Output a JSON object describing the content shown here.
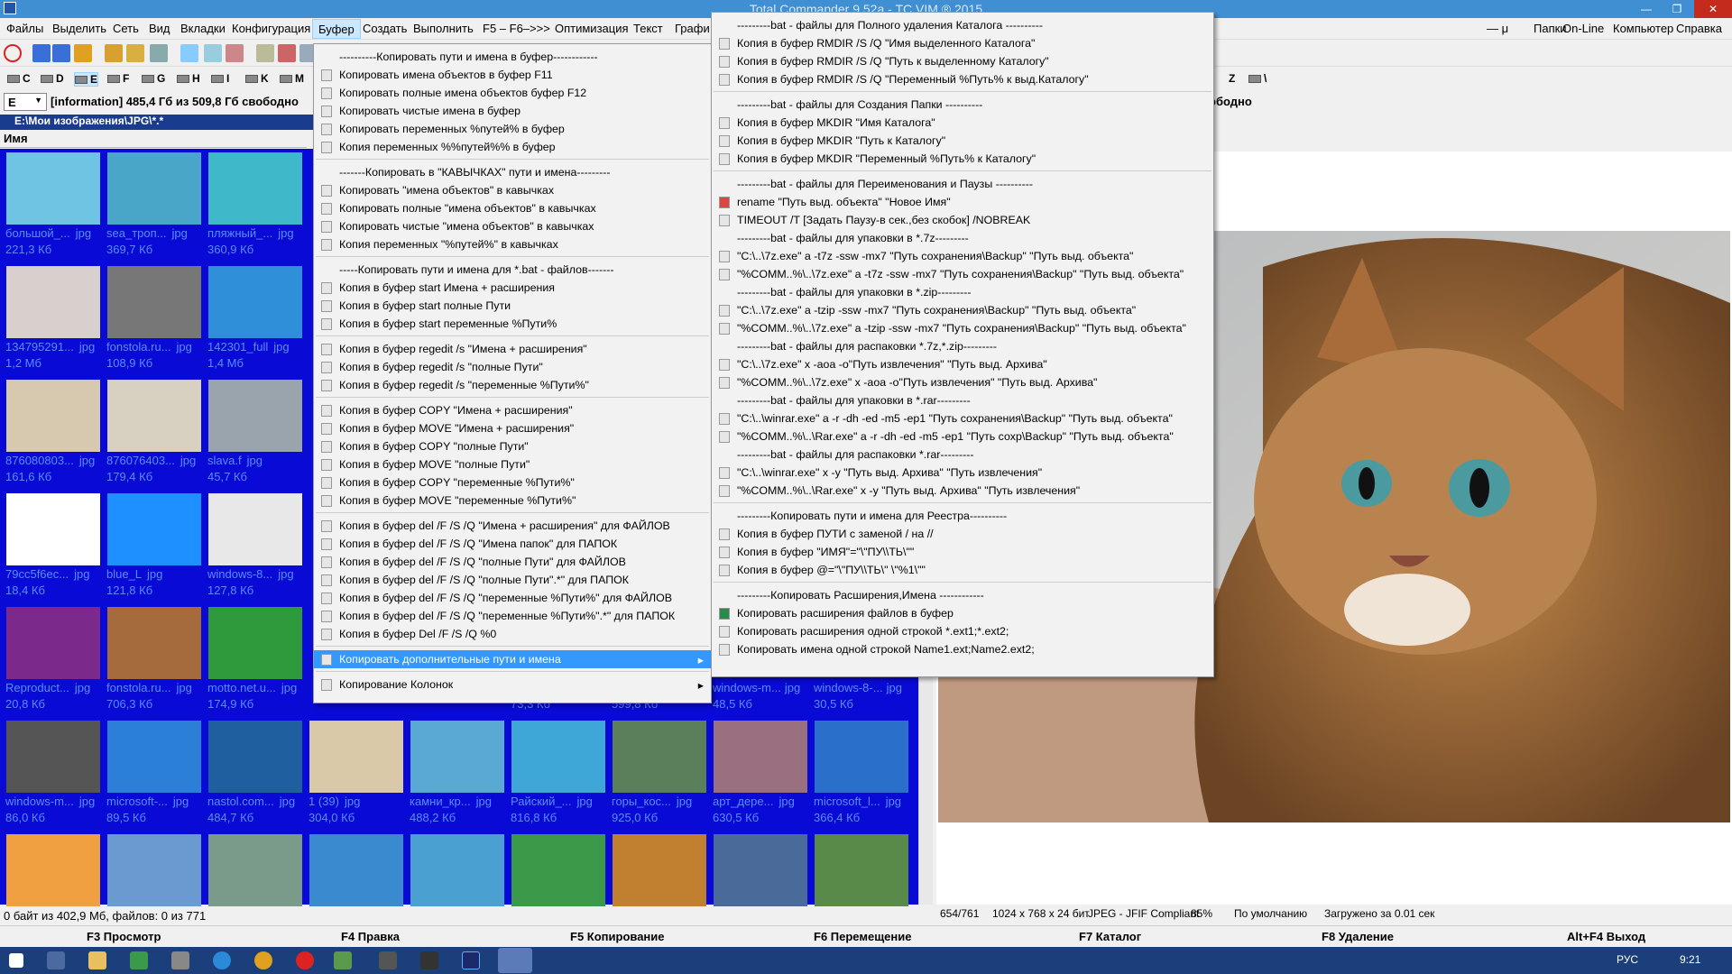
{
  "window": {
    "title": "Total Commander 9.52a - TC VIM ® 2015",
    "minimize": "—",
    "maximize": "❐",
    "close": "✕"
  },
  "menubar": {
    "items": [
      "Файлы",
      "Выделить",
      "Сеть",
      "Вид",
      "Вкладки",
      "Конфигурация",
      "Буфер",
      "Создать",
      "Выполнить",
      "F5 – F6–>>>",
      "Оптимизация",
      "Текст",
      "Графи"
    ],
    "right": [
      "— μ",
      "Папки",
      "On-Line",
      "Компьютер",
      "Справка"
    ]
  },
  "drives": {
    "left": [
      "C",
      "D",
      "E",
      "F",
      "G",
      "H",
      "I",
      "K",
      "M"
    ],
    "right": [
      "Z",
      "\\"
    ]
  },
  "left_panel": {
    "drive": "E",
    "info": "[information]  485,4 Гб из 509,8 Гб свободно",
    "path": "E:\\Мои изображения\\JPG\\*.*",
    "column": "Имя",
    "status": "0 байт из 402,9 Мб, файлов: 0 из 771"
  },
  "right_panel": {
    "free": "ободно"
  },
  "thumbnails": [
    {
      "name": "большой_...",
      "ext": "jpg",
      "size": "221,3 Кб",
      "color": "#6fc3e3"
    },
    {
      "name": "sea_троп...",
      "ext": "jpg",
      "size": "369,7 Кб",
      "color": "#4aa6c8"
    },
    {
      "name": "пляжный_...",
      "ext": "jpg",
      "size": "360,9 Кб",
      "color": "#3fb9c9"
    },
    {
      "name": "134795291...",
      "ext": "jpg",
      "size": "1,2 Мб",
      "color": "#d8d0cc"
    },
    {
      "name": "fonstola.ru...",
      "ext": "jpg",
      "size": "108,9 Кб",
      "color": "#777"
    },
    {
      "name": "142301_full",
      "ext": "jpg",
      "size": "1,4 Мб",
      "color": "#2f8fd8"
    },
    {
      "name": "876080803...",
      "ext": "jpg",
      "size": "161,6 Кб",
      "color": "#d6c9b0"
    },
    {
      "name": "876076403...",
      "ext": "jpg",
      "size": "179,4 Кб",
      "color": "#d8d0c0"
    },
    {
      "name": "slava.f",
      "ext": "jpg",
      "size": "45,7 Кб",
      "color": "#9aa4ac"
    },
    {
      "name": "79cc5f6ec...",
      "ext": "jpg",
      "size": "18,4 Кб",
      "color": "#ffffff"
    },
    {
      "name": "blue_L",
      "ext": "jpg",
      "size": "121,8 Кб",
      "color": "#1e90ff"
    },
    {
      "name": "windows-8...",
      "ext": "jpg",
      "size": "127,8 Кб",
      "color": "#e8e8e8"
    },
    {
      "name": "Reproduct...",
      "ext": "jpg",
      "size": "20,8 Кб",
      "color": "#7b2a8c"
    },
    {
      "name": "fonstola.ru...",
      "ext": "jpg",
      "size": "706,3 Кб",
      "color": "#a56b3c"
    },
    {
      "name": "motto.net.u...",
      "ext": "jpg",
      "size": "174,9 Кб",
      "color": "#2e9a3c"
    },
    {
      "name": "windows-m...",
      "ext": "jpg",
      "size": "86,0 Кб",
      "color": "#555"
    },
    {
      "name": "microsoft-...",
      "ext": "jpg",
      "size": "89,5 Кб",
      "color": "#2b7fd6"
    },
    {
      "name": "nastol.com...",
      "ext": "jpg",
      "size": "484,7 Кб",
      "color": "#1f5f9f"
    },
    {
      "name": "1 (39)",
      "ext": "jpg",
      "size": "304,0 Кб",
      "color": "#d9c9a9"
    },
    {
      "name": "камни_кр...",
      "ext": "jpg",
      "size": "488,2 Кб",
      "color": "#5aa9d4"
    },
    {
      "name": "Райский_...",
      "ext": "jpg",
      "size": "816,8 Кб",
      "color": "#3fa6d8"
    },
    {
      "name": "горы_кос...",
      "ext": "jpg",
      "size": "925,0 Кб",
      "color": "#5a7f5a"
    },
    {
      "name": "арт_дере...",
      "ext": "jpg",
      "size": "630,5 Кб",
      "color": "#9a6f7f"
    },
    {
      "name": "microsoft_l...",
      "ext": "jpg",
      "size": "366,4 Кб",
      "color": "#2a6fc9"
    }
  ],
  "row7_sizes": [
    "73,3 Кб",
    "599,8 Кб"
  ],
  "row7_right": [
    {
      "name": "windows-m...",
      "ext": "jpg",
      "size": "48,5 Кб"
    },
    {
      "name": "windows-8-...",
      "ext": "jpg",
      "size": "30,5 Кб"
    }
  ],
  "viewer_status": [
    "654/761",
    "1024 x 768 x 24 бит",
    "JPEG - JFIF Compliant",
    "85%",
    "По умолчанию",
    "Загружено за 0.01 сек"
  ],
  "fkeys": [
    "F3 Просмотр",
    "F4 Правка",
    "F5 Копирование",
    "F6 Перемещение",
    "F7 Каталог",
    "F8 Удаление",
    "Alt+F4 Выход"
  ],
  "taskbar": {
    "lang": "РУС",
    "time": "9:21"
  },
  "menu1": [
    {
      "t": "----------Копировать пути и имена в буфер------------",
      "h": true
    },
    {
      "t": "Копировать имена объектов в буфер    F11"
    },
    {
      "t": "Копировать полные имена объектов буфер    F12"
    },
    {
      "t": "Копировать чистые имена в буфер"
    },
    {
      "t": "Копировать переменных %путей% в буфер"
    },
    {
      "t": "Копия переменных %%путей%% в буфер"
    },
    {
      "sep": true
    },
    {
      "t": "-------Копировать в \"КАВЫЧКАХ\" пути и имена---------",
      "h": true
    },
    {
      "t": "Копировать \"имена объектов\" в кавычках"
    },
    {
      "t": "Копировать полные \"имена объектов\" в кавычках"
    },
    {
      "t": "Копировать чистые \"имена объектов\" в кавычках"
    },
    {
      "t": "Копия переменных \"%путей%\" в кавычках"
    },
    {
      "sep": true
    },
    {
      "t": "-----Копировать пути и имена для *.bat - файлов-------",
      "h": true
    },
    {
      "t": "Копия в буфер  start Имена + расширения"
    },
    {
      "t": "Копия в буфер  start полные Пути"
    },
    {
      "t": "Копия в буфер  start переменные %Пути%"
    },
    {
      "sep": true
    },
    {
      "t": "Копия в буфер  regedit /s \"Имена + расширения\""
    },
    {
      "t": "Копия в буфер  regedit /s \"полные Пути\""
    },
    {
      "t": "Копия в буфер  regedit /s \"переменные %Пути%\""
    },
    {
      "sep": true
    },
    {
      "t": "Копия в буфер  COPY \"Имена + расширения\""
    },
    {
      "t": "Копия в буфер  MOVE \"Имена + расширения\""
    },
    {
      "t": "Копия в буфер  COPY \"полные Пути\""
    },
    {
      "t": "Копия в буфер  MOVE \"полные Пути\""
    },
    {
      "t": "Копия в буфер  COPY \"переменные %Пути%\""
    },
    {
      "t": "Копия в буфер  MOVE \"переменные %Пути%\""
    },
    {
      "sep": true
    },
    {
      "t": "Копия в буфер  del /F /S /Q \"Имена + расширения\"  для ФАЙЛОВ"
    },
    {
      "t": "Копия в буфер  del /F /S /Q \"Имена папок\"  для ПАПОК"
    },
    {
      "t": "Копия в буфер  del /F /S /Q \"полные Пути\"  для ФАЙЛОВ"
    },
    {
      "t": "Копия в буфер  del /F /S /Q \"полные Пути\".*\"  для ПАПОК"
    },
    {
      "t": "Копия в буфер  del /F /S /Q \"переменные %Пути%\"  для ФАЙЛОВ"
    },
    {
      "t": "Копия в буфер  del /F /S /Q \"переменные %Пути%\".*\"  для ПАПОК"
    },
    {
      "t": "Копия в буфер  Del /F /S /Q %0"
    },
    {
      "sep": true
    },
    {
      "t": "Копировать дополнительные пути и имена",
      "sel": true,
      "sub": true
    },
    {
      "sep": true
    },
    {
      "t": "Копирование Колонок",
      "sub": true
    }
  ],
  "menu2": [
    {
      "t": "---------bat - файлы для Полного удаления Каталога ----------",
      "h": true
    },
    {
      "t": "Копия в буфер  RMDIR /S /Q \"Имя выделенного Каталога\""
    },
    {
      "t": "Копия в буфер  RMDIR /S /Q \"Путь к выделенному Каталогу\""
    },
    {
      "t": "Копия в буфер  RMDIR /S /Q \"Переменный %Путь% к  выд.Каталогу\""
    },
    {
      "sep": true
    },
    {
      "t": "---------bat - файлы для Создания Папки ----------",
      "h": true
    },
    {
      "t": "Копия в буфер  MKDIR \"Имя Каталога\""
    },
    {
      "t": "Копия в буфер  MKDIR \"Путь к  Каталогу\""
    },
    {
      "t": "Копия в буфер  MKDIR \"Переменный %Путь% к  Каталогу\""
    },
    {
      "sep": true
    },
    {
      "t": "---------bat - файлы для Переименования и Паузы ----------",
      "h": true
    },
    {
      "t": "rename \"Путь выд. объекта\" \"Новое Имя\"",
      "icon": "name"
    },
    {
      "t": "TIMEOUT /T [Задать Паузу-в сек.,без скобок]  /NOBREAK"
    },
    {
      "t": "---------bat - файлы для упаковки в *.7z---------",
      "h": true
    },
    {
      "t": "\"C:\\..\\7z.exe\" a -t7z -ssw -mx7 \"Путь сохранения\\Backup\" \"Путь выд. объекта\""
    },
    {
      "t": "\"%COMM..%\\..\\7z.exe\" a -t7z -ssw -mx7 \"Путь сохранения\\Backup\" \"Путь выд. объекта\""
    },
    {
      "t": "---------bat - файлы для упаковки в *.zip---------",
      "h": true
    },
    {
      "t": "\"C:\\..\\7z.exe\" a -tzip -ssw -mx7 \"Путь сохранения\\Backup\" \"Путь выд. объекта\""
    },
    {
      "t": "\"%COMM..%\\..\\7z.exe\" a -tzip -ssw -mx7 \"Путь сохранения\\Backup\" \"Путь выд. объекта\""
    },
    {
      "t": "---------bat - файлы для распаковки *.7z,*.zip---------",
      "h": true
    },
    {
      "t": "\"C:\\..\\7z.exe\" x -aoa -o\"Путь извлечения\" \"Путь выд. Архива\""
    },
    {
      "t": "\"%COMM..%\\..\\7z.exe\" x -aoa -o\"Путь извлечения\" \"Путь выд. Архива\""
    },
    {
      "t": "---------bat - файлы для упаковки в *.rar---------",
      "h": true
    },
    {
      "t": "\"C:\\..\\winrar.exe\" a -r -dh -ed -m5 -ep1 \"Путь сохранения\\Backup\" \"Путь выд. объекта\""
    },
    {
      "t": "\"%COMM..%\\..\\Rar.exe\" a -r -dh -ed -m5 -ep1 \"Путь сохр\\Backup\" \"Путь выд. объекта\""
    },
    {
      "t": "---------bat - файлы для распаковки *.rar---------",
      "h": true
    },
    {
      "t": "\"C:\\..\\winrar.exe\" x -y \"Путь выд. Архива\" \"Путь извлечения\""
    },
    {
      "t": "\"%COMM..%\\..\\Rar.exe\" x -y \"Путь выд. Архива\" \"Путь извлечения\""
    },
    {
      "sep": true
    },
    {
      "t": "---------Копировать пути и имена для Реестра----------",
      "h": true
    },
    {
      "t": "Копия в буфер  ПУТИ с заменой / на //"
    },
    {
      "t": "Копия в буфер  \"ИМЯ\"=\"\\\"ПУ\\\\ТЬ\\\"\""
    },
    {
      "t": "Копия в буфер  @=\"\\\"ПУ\\\\ТЬ\\\" \\\"%1\\\"\""
    },
    {
      "sep": true
    },
    {
      "t": "---------Копировать Расширения,Имена ------------",
      "h": true
    },
    {
      "t": "Копировать расширения файлов в буфер",
      "icon": "exe"
    },
    {
      "t": "Копировать расширения одной строкой  *.ext1;*.ext2;"
    },
    {
      "t": "Копировать имена одной строкой  Name1.ext;Name2.ext2;"
    }
  ],
  "colors": {
    "panel_bg": "#0a0ad6",
    "path_bg": "#1a3c8f",
    "menu_sel": "#3399ff",
    "taskbar": "#1a3f7a"
  }
}
